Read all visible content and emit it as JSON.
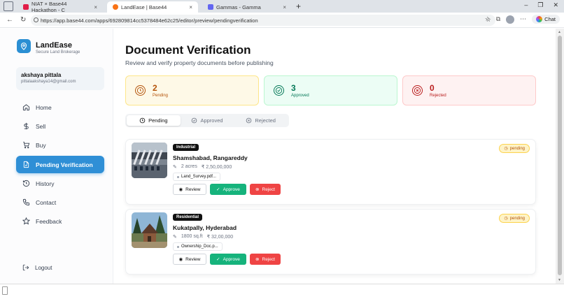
{
  "browser": {
    "tabs": [
      {
        "title": "NIAT × Base44 Hackathon - C",
        "color": "#e11d48"
      },
      {
        "title": "LandEase | Base44",
        "color": "#f97316"
      },
      {
        "title": "Gammas - Gamma",
        "color": "#6366f1"
      }
    ],
    "url": "https://app.base44.com/apps/692809814cc5378484e62c25/editor/preview/pendingverification",
    "chat_label": "Chat"
  },
  "sidebar": {
    "brand": "LandEase",
    "tagline": "Secure Land Brokerage",
    "user_name": "akshaya pittala",
    "user_email": "pittalaakshaya14@gmail.com",
    "items": [
      {
        "label": "Home",
        "icon": "home-icon"
      },
      {
        "label": "Sell",
        "icon": "dollar-icon"
      },
      {
        "label": "Buy",
        "icon": "cart-icon"
      },
      {
        "label": "Pending Verification",
        "icon": "file-check-icon"
      },
      {
        "label": "History",
        "icon": "history-icon"
      },
      {
        "label": "Contact",
        "icon": "phone-icon"
      },
      {
        "label": "Feedback",
        "icon": "star-icon"
      }
    ],
    "logout": "Logout"
  },
  "header": {
    "title": "Document Verification",
    "subtitle": "Review and verify property documents before publishing"
  },
  "stats": [
    {
      "value": "2",
      "label": "Pending",
      "color": "#b45309",
      "bg": "#fef9e7",
      "border": "#fde68a"
    },
    {
      "value": "3",
      "label": "Approved",
      "color": "#047857",
      "bg": "#ecfdf5",
      "border": "#bbf7d0"
    },
    {
      "value": "0",
      "label": "Rejected",
      "color": "#b91c1c",
      "bg": "#fef2f2",
      "border": "#fecaca"
    }
  ],
  "filter_tabs": [
    "Pending",
    "Approved",
    "Rejected"
  ],
  "listings": [
    {
      "type": "Industrial",
      "location": "Shamshabad, Rangareddy",
      "size": "2 acres",
      "price": "₹ 2,50,00,000",
      "document": "Land_Survey.pdf...",
      "status": "pending"
    },
    {
      "type": "Residential",
      "location": "Kukatpally, Hyderabad",
      "size": "1800 sq.ft",
      "price": "₹ 32,00,000",
      "document": "Ownership_Doc.p...",
      "status": "pending"
    }
  ],
  "actions": {
    "review": "Review",
    "approve": "Approve",
    "reject": "Reject"
  }
}
